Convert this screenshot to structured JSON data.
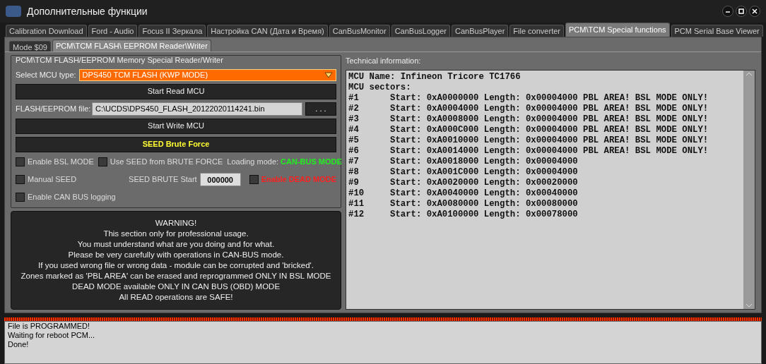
{
  "window": {
    "title": "Дополнительные функции"
  },
  "tabs": [
    {
      "label": "Calibration Download",
      "selected": false
    },
    {
      "label": "Ford - Audio",
      "selected": false
    },
    {
      "label": "Focus II Зеркала",
      "selected": false
    },
    {
      "label": "Настройка CAN (Дата и Время)",
      "selected": false
    },
    {
      "label": "CanBusMonitor",
      "selected": false
    },
    {
      "label": "CanBusLogger",
      "selected": false
    },
    {
      "label": "CanBusPlayer",
      "selected": false
    },
    {
      "label": "File converter",
      "selected": false
    },
    {
      "label": "PCM\\TCM Special functions",
      "selected": true
    },
    {
      "label": "PCM Serial Base Viewer",
      "selected": false
    }
  ],
  "subtabs": [
    {
      "label": "Mode $09",
      "selected": false
    },
    {
      "label": "PCM\\TCM FLASH\\ EEPROM  Reader\\Writer",
      "selected": true
    }
  ],
  "reader": {
    "group_title": "PCM\\TCM FLASH/EEPROM Memory Special Reader/Writer",
    "mcu_label": "Select MCU type:",
    "mcu_value": "DPS450 TCM FLASH (KWP MODE)",
    "read_button": "Start Read MCU",
    "file_label": "FLASH/EEPROM file:",
    "file_value": "C:\\UCDS\\DPS450_FLASH_20122020114241.bin",
    "browse_button": ". . .",
    "write_button": "Start Write MCU",
    "seed_button": "SEED Brute Force",
    "enable_bsl": {
      "label": "Enable BSL MODE",
      "checked": false
    },
    "use_seed": {
      "label": "Use SEED from BRUTE FORCE",
      "checked": false
    },
    "loading_mode_label": "Loading mode:",
    "loading_mode_value": "CAN-BUS MODE",
    "manual_seed": {
      "label": "Manual SEED",
      "checked": false
    },
    "seed_start_label": "SEED BRUTE Start",
    "seed_start_value": "000000",
    "dead_mode": {
      "label": "Enable DEAD MODE",
      "checked": false
    },
    "can_logging": {
      "label": "Enable CAN BUS logging",
      "checked": false
    }
  },
  "warning": [
    "WARNING!",
    "This section only for professional usage.",
    "You must understand what are you doing and for what.",
    "Please be very carefully with operations in CAN-BUS mode.",
    "If you used wrong file or wrong data - module can be corrupted and 'bricked'.",
    "Zones marked as 'PBL AREA' can be erased and reprogrammed ONLY IN BSL MODE",
    "DEAD MODE available ONLY IN CAN BUS (OBD) MODE",
    "All READ operations are SAFE!"
  ],
  "tech_info": {
    "title": "Technical information:",
    "lines": [
      "MCU Name: Infineon Tricore TC1766",
      "MCU sectors:",
      "#1      Start: 0xA0000000 Length: 0x00004000 PBL AREA! BSL MODE ONLY!",
      "#2      Start: 0xA0004000 Length: 0x00004000 PBL AREA! BSL MODE ONLY!",
      "#3      Start: 0xA0008000 Length: 0x00004000 PBL AREA! BSL MODE ONLY!",
      "#4      Start: 0xA000C000 Length: 0x00004000 PBL AREA! BSL MODE ONLY!",
      "#5      Start: 0xA0010000 Length: 0x00004000 PBL AREA! BSL MODE ONLY!",
      "#6      Start: 0xA0014000 Length: 0x00004000 PBL AREA! BSL MODE ONLY!",
      "#7      Start: 0xA0018000 Length: 0x00004000",
      "#8      Start: 0xA001C000 Length: 0x00004000",
      "#9      Start: 0xA0020000 Length: 0x00020000",
      "#10     Start: 0xA0040000 Length: 0x00040000",
      "#11     Start: 0xA0080000 Length: 0x00080000",
      "#12     Start: 0xA0100000 Length: 0x00078000"
    ]
  },
  "log": [
    "File is PROGRAMMED!",
    "Waiting for reboot PCM...",
    "Done!"
  ]
}
